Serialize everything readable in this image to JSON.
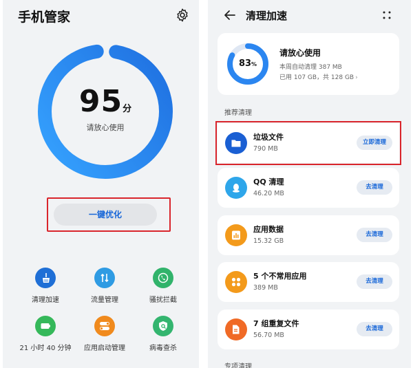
{
  "left": {
    "title": "手机管家",
    "score": "95",
    "score_unit": "分",
    "score_status": "请放心使用",
    "optimize_button": "一键优化",
    "tiles": [
      {
        "label": "清理加速",
        "icon": "broom-icon",
        "color": "#1f6fd6"
      },
      {
        "label": "流量管理",
        "icon": "data-transfer-icon",
        "color": "#2f9be3"
      },
      {
        "label": "骚扰拦截",
        "icon": "phone-block-icon",
        "color": "#31b36b"
      },
      {
        "label": "21 小时 40 分钟",
        "icon": "battery-icon",
        "color": "#35b85a"
      },
      {
        "label": "应用启动管理",
        "icon": "toggle-icon",
        "color": "#f08a1d"
      },
      {
        "label": "病毒查杀",
        "icon": "shield-scan-icon",
        "color": "#33b56f"
      }
    ]
  },
  "right": {
    "title": "清理加速",
    "storage": {
      "percent": "83",
      "percent_unit": "%",
      "percent_value": 0.83,
      "status": "请放心使用",
      "weekly_auto_clean": "本周自动清理 387 MB",
      "usage": "已用 107 GB，共 128 GB"
    },
    "recommended_header": "推荐清理",
    "items": [
      {
        "name": "垃圾文件",
        "size": "790 MB",
        "button": "立即清理",
        "icon": "folder-icon",
        "color": "#1a5fd3"
      },
      {
        "name": "QQ 清理",
        "size": "46.20 MB",
        "button": "去清理",
        "icon": "qq-icon",
        "color": "#2ea6ea"
      },
      {
        "name": "应用数据",
        "size": "15.32 GB",
        "button": "去清理",
        "icon": "bar-chart-icon",
        "color": "#f39a1b"
      },
      {
        "name": "5 个不常用应用",
        "size": "389 MB",
        "button": "去清理",
        "icon": "apps-grid-icon",
        "color": "#f39a1b"
      },
      {
        "name": "7 组重复文件",
        "size": "56.70 MB",
        "button": "去清理",
        "icon": "duplicate-file-icon",
        "color": "#f06a26"
      }
    ],
    "special_header": "专项清理"
  },
  "colors": {
    "accent": "#1565d8",
    "ring_start": "#2f9cff",
    "ring_end": "#1f6fe0",
    "highlight_box": "#d9242b"
  }
}
